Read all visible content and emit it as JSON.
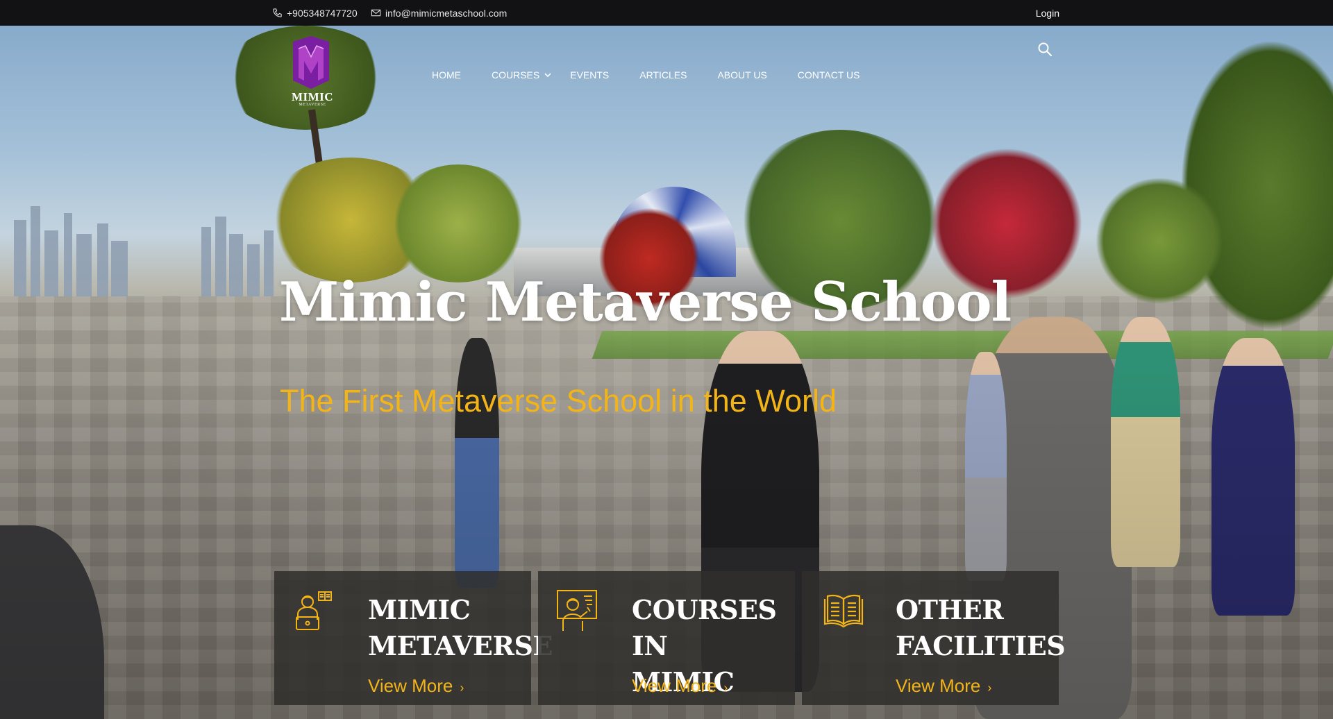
{
  "topbar": {
    "phone": "+905348747720",
    "email": "info@mimicmetaschool.com",
    "login_label": "Login",
    "phone_icon": "phone-icon",
    "email_icon": "mail-icon"
  },
  "brand": {
    "logo_text": "MIMIC",
    "logo_sub": "METAVERSE",
    "logo_color": "#8e24aa"
  },
  "nav": {
    "items": [
      {
        "label": "HOME"
      },
      {
        "label": "COURSES",
        "has_dropdown": true
      },
      {
        "label": "EVENTS"
      },
      {
        "label": "ARTICLES"
      },
      {
        "label": "ABOUT US"
      },
      {
        "label": "CONTACT US"
      }
    ],
    "search_icon": "search-icon"
  },
  "hero": {
    "title": "Mimic Metaverse School",
    "subtitle": "The First Metaverse School in the World"
  },
  "cards": [
    {
      "title_line1": "MIMIC",
      "title_line2": "METAVERSE",
      "link": "View More",
      "icon": "student-laptop-icon"
    },
    {
      "title_line1": "COURSES IN",
      "title_line2": "MIMIC",
      "link": "View More",
      "icon": "teacher-board-icon"
    },
    {
      "title_line1": "OTHER",
      "title_line2": "FACILITIES",
      "link": "View More",
      "icon": "open-book-icon"
    }
  ],
  "colors": {
    "accent": "#f3b418",
    "topbar_bg": "#121214",
    "card_bg": "#302e2c"
  }
}
